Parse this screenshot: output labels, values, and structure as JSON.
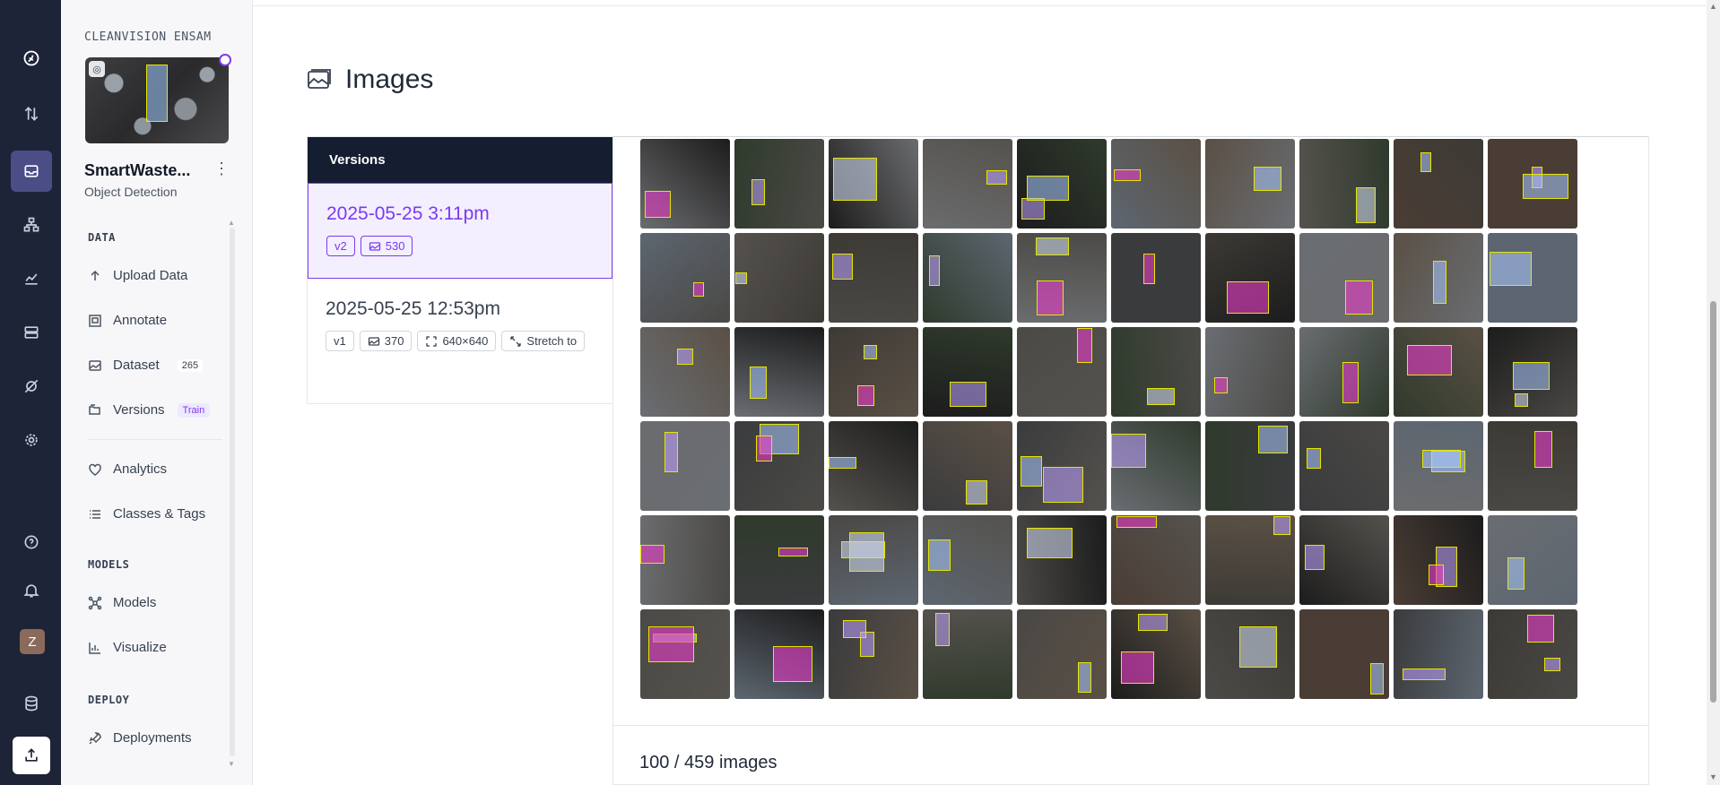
{
  "workspace": {
    "name": "CLEANVISION ENSAM"
  },
  "project": {
    "title": "SmartWaste...",
    "type": "Object Detection"
  },
  "sidebar": {
    "sections": [
      {
        "label": "DATA"
      },
      {
        "label": "MODELS"
      },
      {
        "label": "DEPLOY"
      }
    ],
    "items": {
      "upload": {
        "label": "Upload Data",
        "icon": "arrow-up-icon"
      },
      "annotate": {
        "label": "Annotate",
        "icon": "annotate-icon"
      },
      "dataset": {
        "label": "Dataset",
        "icon": "image-stack-icon",
        "count": "265"
      },
      "versions": {
        "label": "Versions",
        "icon": "folders-icon",
        "badge": "Train"
      },
      "analytics": {
        "label": "Analytics",
        "icon": "heart-pulse-icon"
      },
      "classes": {
        "label": "Classes & Tags",
        "icon": "list-icon"
      },
      "models": {
        "label": "Models",
        "icon": "models-icon"
      },
      "visualize": {
        "label": "Visualize",
        "icon": "chart-icon"
      },
      "deployments": {
        "label": "Deployments",
        "icon": "rocket-icon"
      }
    }
  },
  "page": {
    "title": "Images",
    "icon": "images-icon"
  },
  "versions": {
    "header": "Versions",
    "list": [
      {
        "date": "2025-05-25 3:11pm",
        "version": "v2",
        "images": "530",
        "selected": true
      },
      {
        "date": "2025-05-25 12:53pm",
        "version": "v1",
        "images": "370",
        "size": "640×640",
        "resize": "Stretch to",
        "selected": false
      }
    ]
  },
  "gallery": {
    "count_text": "100 / 459 images",
    "rows": 6,
    "cols": 10
  },
  "colors": {
    "rail_bg": "#1d2437",
    "accent": "#7c3aed",
    "bbox": "#e5e500",
    "versions_header": "#151d30"
  }
}
